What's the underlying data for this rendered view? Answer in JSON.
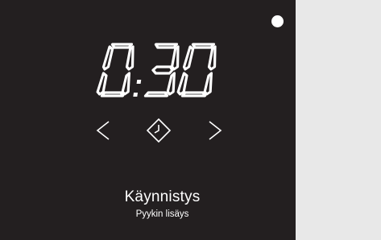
{
  "display": {
    "time": "0:30",
    "indicator_color": "#ffffff",
    "background_color": "#231f20",
    "page_background": "#e8e8e8"
  },
  "controls": {
    "prev_icon": "chevron-left-icon",
    "clock_icon": "clock-diamond-icon",
    "next_icon": "chevron-right-icon"
  },
  "option": {
    "label": "Käynnistys",
    "sublabel": "Pyykin lisäys"
  }
}
